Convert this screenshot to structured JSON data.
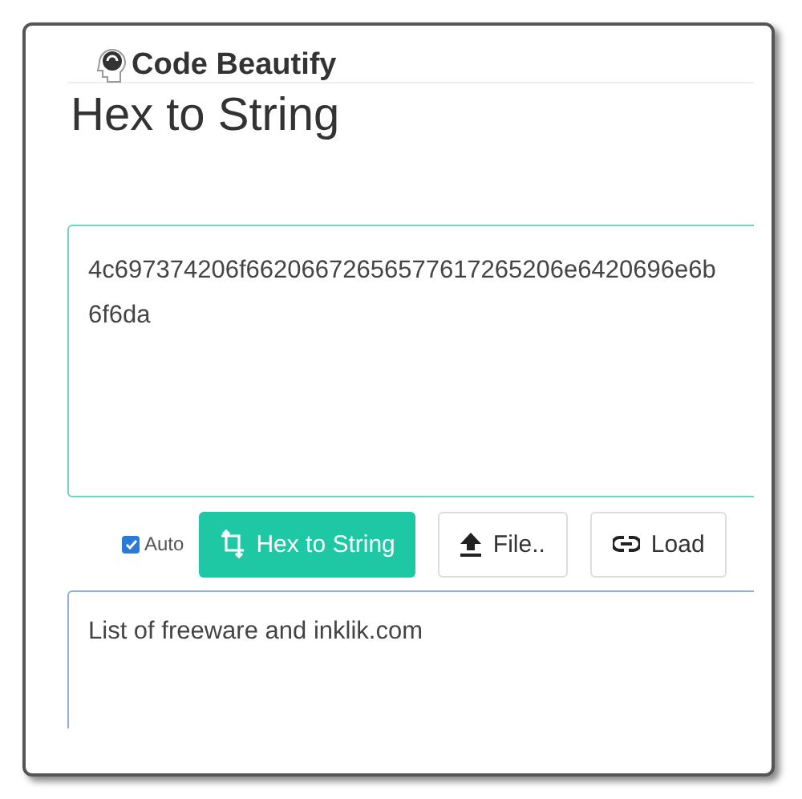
{
  "header": {
    "brand": "Code Beautify"
  },
  "page_title": "Hex to String",
  "input": {
    "lines": [
      "4c697374206f66206672656577617265206e6420696e6b",
      "6f6da"
    ]
  },
  "toolbar": {
    "auto": {
      "label": "Auto",
      "checked": true
    },
    "buttons": [
      {
        "kind": "convert",
        "label": "Hex to String"
      },
      {
        "kind": "upload",
        "label": "File.."
      },
      {
        "kind": "link",
        "label": "Load"
      }
    ]
  },
  "output": {
    "value": "List of freeware and inklik.com"
  }
}
